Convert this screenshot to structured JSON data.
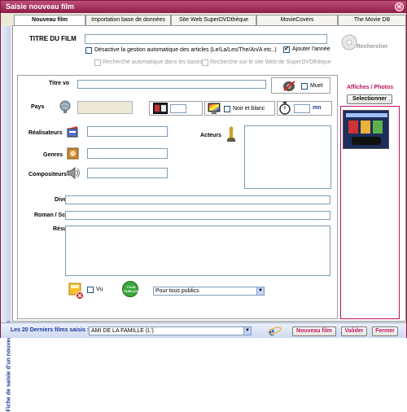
{
  "window": {
    "title": "Saisie nouveau film",
    "close_glyph": "✕"
  },
  "tabs": [
    {
      "label": "Nouveau film"
    },
    {
      "label": "Importation base de données"
    },
    {
      "label": "Site Web SuperDVDthèque"
    },
    {
      "label": "MovieCovers"
    },
    {
      "label": "The Movie DB"
    }
  ],
  "side_label": "Fiche de saisie d'un nouveau film",
  "title_section": {
    "label": "TITRE DU FILM",
    "value": "",
    "disable_auto_articles": "Désactive la gestion automatique des articles  (Le/La/Les/The/An/A etc..)",
    "add_year": "Ajouter l'année",
    "add_year_checked": "✔",
    "auto_search_db": "Recherche automatique dans les bases",
    "search_site": "Recherche sur le site Web de SuperDVDthèque",
    "search_button": "Rechercher"
  },
  "details": {
    "titre_vo": "Titre vo",
    "muet": "Muet",
    "pays": "Pays",
    "noir_blanc": "Noir et blanc",
    "duration_unit": "mn",
    "realisateurs": "Réalisateurs",
    "genres": "Genres",
    "compositeurs": "Compositeurs",
    "acteurs": "Acteurs",
    "divers": "Divers",
    "roman": "Roman / Scénario",
    "resume": "Résumé",
    "vu": "Vu",
    "rating_badge": "TOUS PUBLICS",
    "rating_value": "Pour tous publics"
  },
  "posters": {
    "title": "Affiches / Photos",
    "select_button": "Selectionner"
  },
  "bottom": {
    "last_films_label": "Les 20 Derniers films saisis :",
    "last_film_value": "AMI DE LA FAMILLE (L')",
    "new_button": "Nouveau film",
    "validate_button": "Valider",
    "close_button": "Fermer"
  },
  "colors": {
    "accent": "#c0115f",
    "title_gradient_top": "#c0507a",
    "link_blue": "#1b3a9c"
  }
}
